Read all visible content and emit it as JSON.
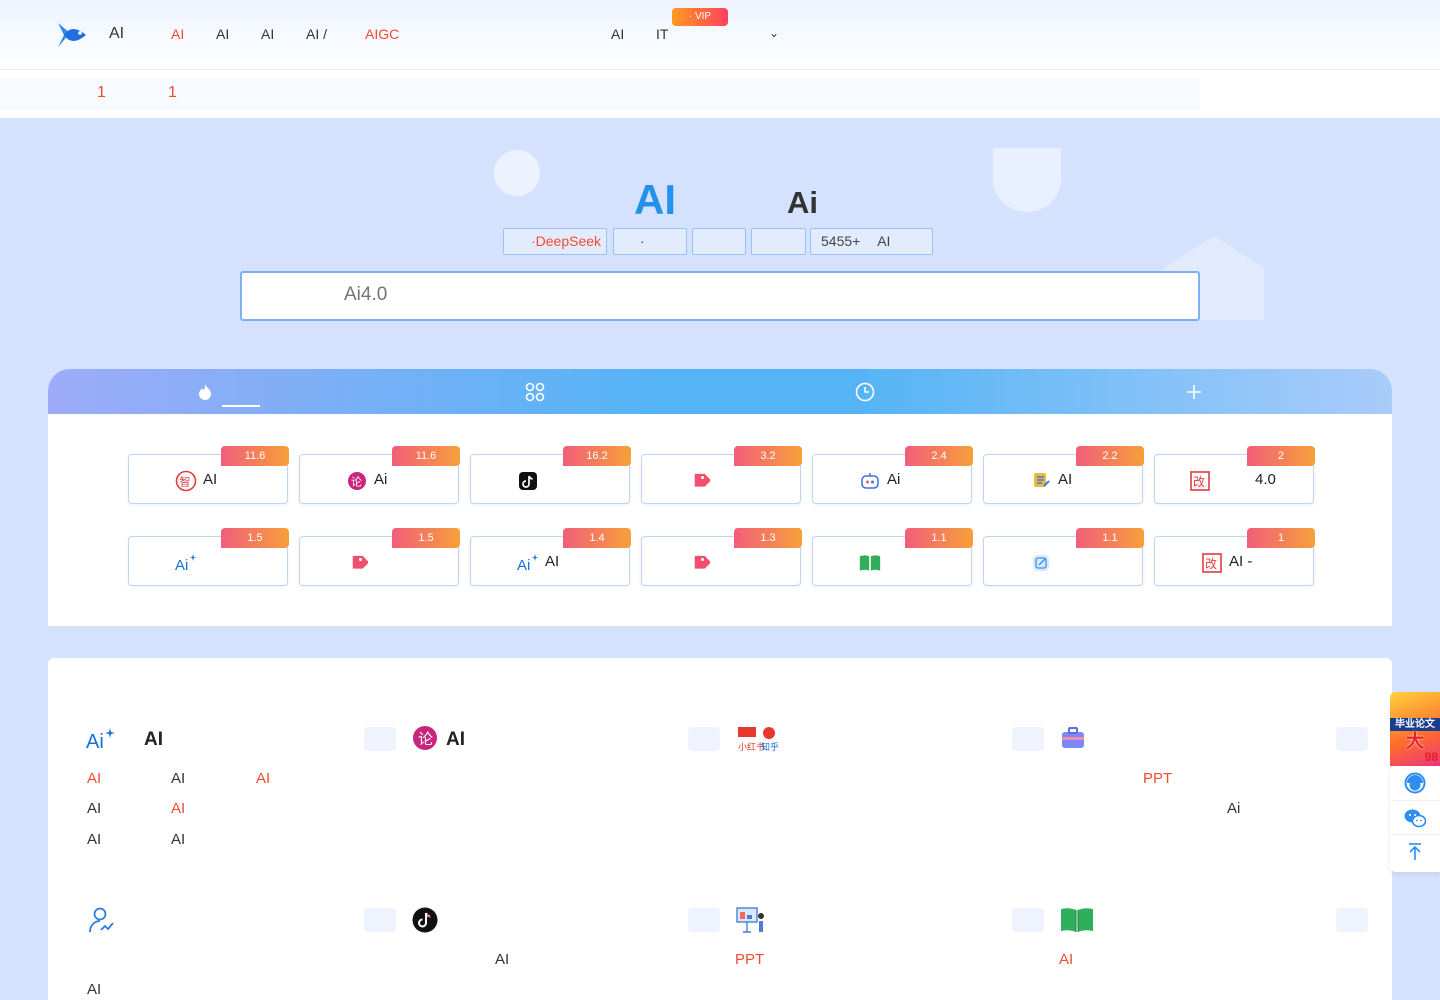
{
  "header": {
    "brand": "AI",
    "nav": [
      {
        "label": "AI",
        "active": true
      },
      {
        "label": "AI"
      },
      {
        "label": "AI"
      },
      {
        "label": "AI /"
      },
      {
        "label": "AIGC",
        "active": true
      },
      {
        "label": "AI"
      },
      {
        "label": "IT"
      }
    ],
    "vip_badge": "· VIP",
    "dropdown_icon": "chevron-down-icon"
  },
  "notice": {
    "items": [
      "1",
      "1"
    ]
  },
  "hero": {
    "title_ai": "AI",
    "title_ai2": "Ai",
    "tags": [
      "·DeepSeek",
      "·",
      "",
      "",
      "5455+",
      "AI"
    ],
    "search_placeholder": "Ai4.0"
  },
  "tabs": {
    "icons": [
      "fire-icon",
      "grid-icon",
      "clock-icon",
      "plus-icon"
    ]
  },
  "hot_tools": [
    {
      "badge": "11.6",
      "icon": "zhi-icon",
      "label": "AI"
    },
    {
      "badge": "11.6",
      "icon": "lun-icon",
      "label": "Ai"
    },
    {
      "badge": "16.2",
      "icon": "douyin-icon",
      "label": ""
    },
    {
      "badge": "3.2",
      "icon": "tag-icon",
      "label": ""
    },
    {
      "badge": "2.4",
      "icon": "robot-icon",
      "label": "Ai"
    },
    {
      "badge": "2.2",
      "icon": "note-icon",
      "label": "AI"
    },
    {
      "badge": "2",
      "icon": "gai-icon",
      "label": "4.0"
    },
    {
      "badge": "1.5",
      "icon": "ai-sparkle-icon",
      "label": ""
    },
    {
      "badge": "1.5",
      "icon": "tag-icon",
      "label": ""
    },
    {
      "badge": "1.4",
      "icon": "ai-sparkle-icon",
      "label": "AI"
    },
    {
      "badge": "1.3",
      "icon": "tag-icon",
      "label": ""
    },
    {
      "badge": "1.1",
      "icon": "book-icon",
      "label": ""
    },
    {
      "badge": "1.1",
      "icon": "edit-icon",
      "label": ""
    },
    {
      "badge": "1",
      "icon": "gai-icon",
      "label": "AI -"
    }
  ],
  "categories": {
    "row1": [
      {
        "icon": "ai-sparkle-icon",
        "title": "AI",
        "links": [
          {
            "text": "AI",
            "hot": true
          },
          {
            "text": "AI"
          },
          {
            "text": "AI",
            "hot": true
          },
          {
            "text": "AI"
          },
          {
            "text": "AI",
            "hot": true
          },
          {
            "text": "AI"
          },
          {
            "text": "AI"
          }
        ]
      },
      {
        "icon": "lun-icon",
        "title": "AI",
        "links": []
      },
      {
        "icon": "social-media-icon",
        "title": "",
        "links": []
      },
      {
        "icon": "briefcase-icon",
        "title": "",
        "links": [
          {
            "text": "PPT",
            "hot": true
          },
          {
            "text": "Ai"
          }
        ]
      }
    ],
    "row2": [
      {
        "icon": "user-growth-icon",
        "title": "",
        "links": [
          {
            "text": "AI"
          }
        ]
      },
      {
        "icon": "douyin-icon",
        "title": "",
        "links": [
          {
            "text": "AI"
          }
        ]
      },
      {
        "icon": "presentation-icon",
        "title": "",
        "links": [
          {
            "text": "PPT",
            "hot": true
          }
        ]
      },
      {
        "icon": "book-icon",
        "title": "",
        "links": [
          {
            "text": "AI",
            "hot": true
          }
        ]
      }
    ]
  },
  "side": {
    "ad_line1": "毕业论文",
    "ad_line2": "大",
    "ad_line3": "98",
    "buttons": [
      "customer-service-icon",
      "wechat-icon",
      "back-to-top-icon"
    ]
  }
}
